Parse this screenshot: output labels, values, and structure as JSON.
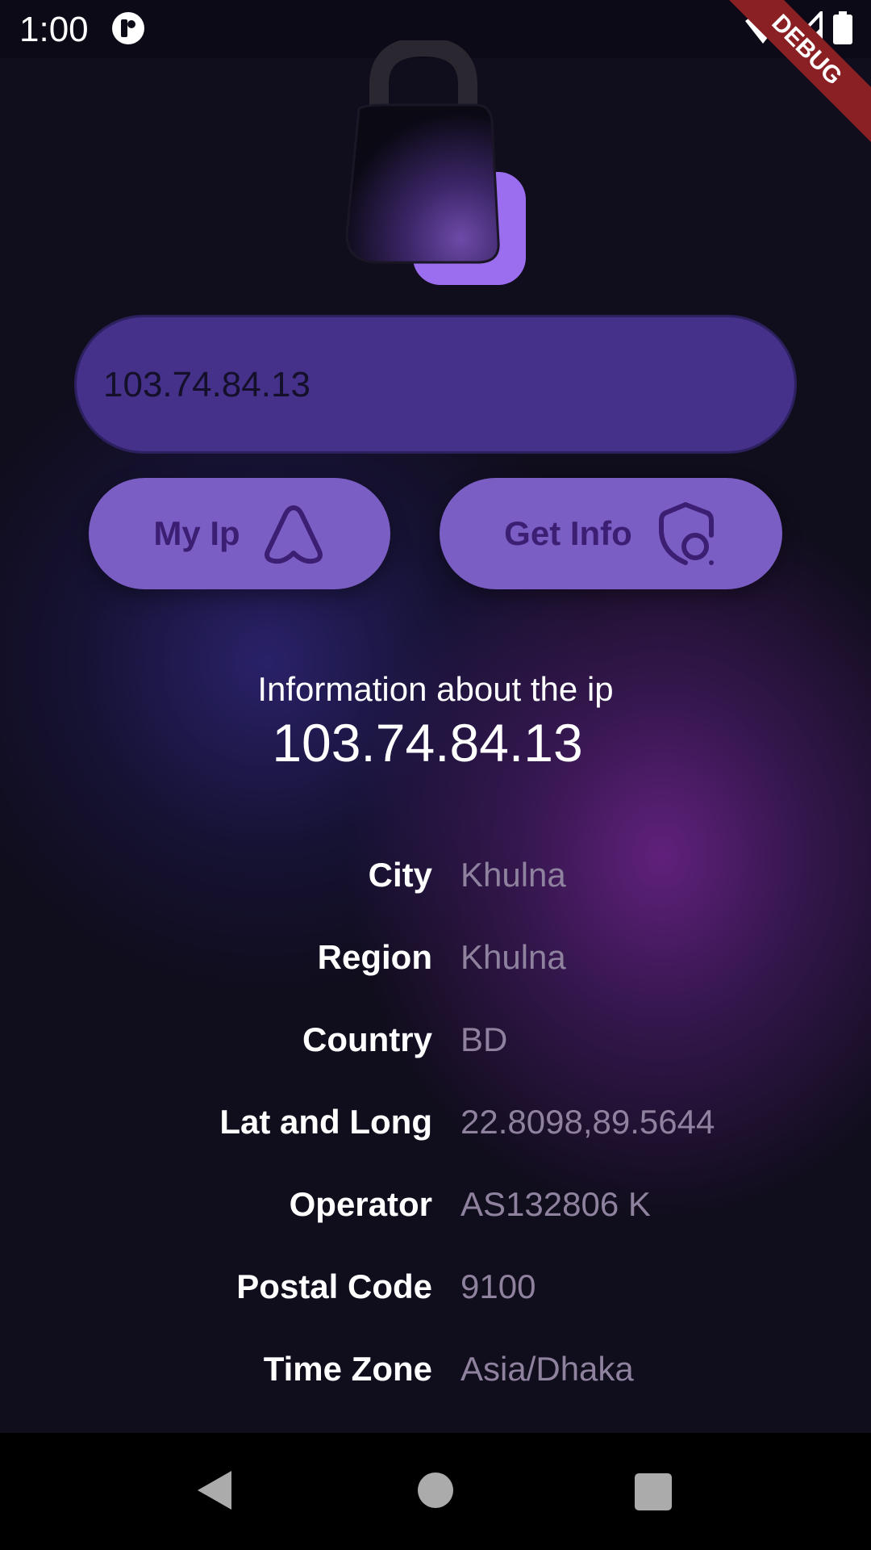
{
  "status_bar": {
    "time": "1:00",
    "debug_banner": "DEBUG"
  },
  "icons": {
    "app": "app-badge-icon",
    "wifi": "wifi-icon",
    "signal": "signal-icon",
    "battery": "battery-icon",
    "logo": "lock-icon",
    "my_ip": "triangle-icon",
    "get_info": "shield-search-icon"
  },
  "search": {
    "value": "103.74.84.13"
  },
  "buttons": {
    "my_ip": "My Ip",
    "get_info": "Get Info"
  },
  "info": {
    "label": "Information about the ip",
    "ip": "103.74.84.13",
    "rows": [
      {
        "key": "City",
        "value": "Khulna"
      },
      {
        "key": "Region",
        "value": "Khulna"
      },
      {
        "key": "Country",
        "value": "BD"
      },
      {
        "key": "Lat and Long",
        "value": "22.8098,89.5644"
      },
      {
        "key": "Operator",
        "value": "AS132806 K"
      },
      {
        "key": "Postal Code",
        "value": "9100"
      },
      {
        "key": "Time Zone",
        "value": "Asia/Dhaka"
      }
    ]
  },
  "colors": {
    "background": "#100d1c",
    "field": "#45308a",
    "button": "#7a5ec4",
    "button_text": "#3c1f73",
    "value_text": "#8f829f",
    "debug": "#8a1f24"
  }
}
